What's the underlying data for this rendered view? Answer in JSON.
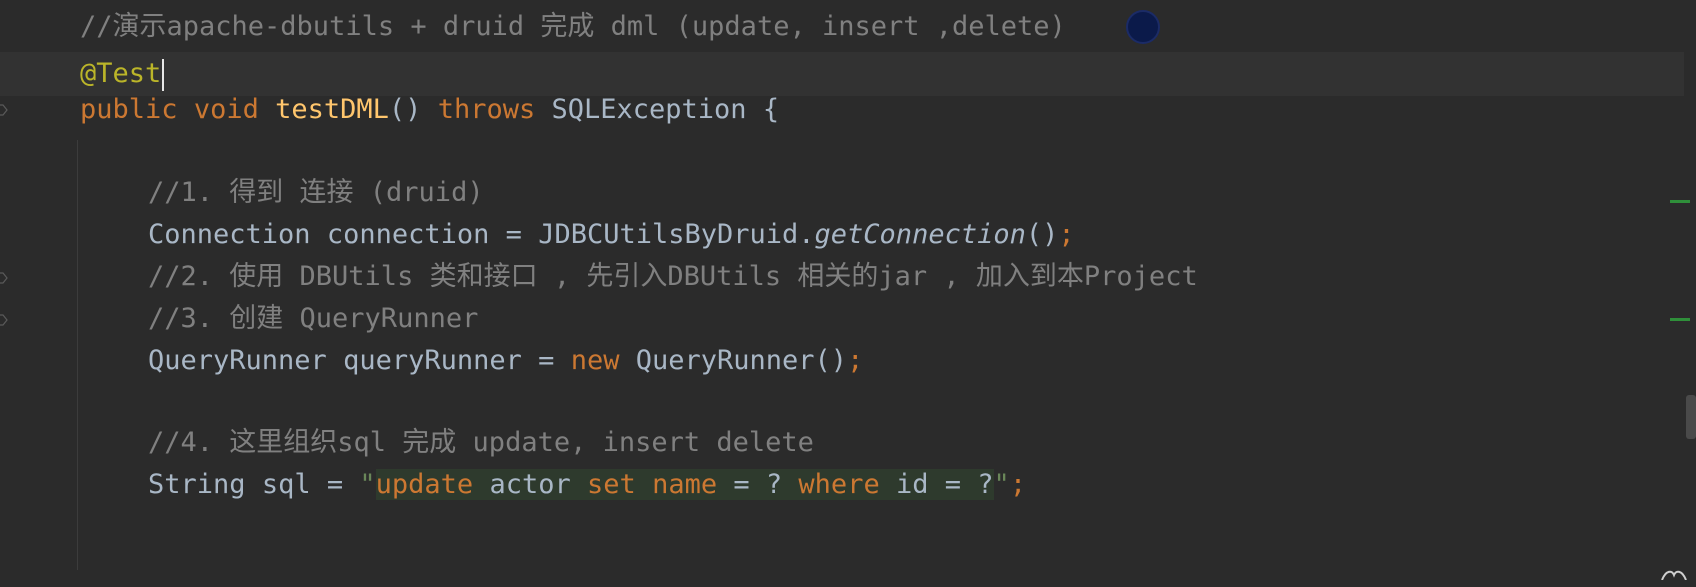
{
  "editor": {
    "lines": [
      {
        "comment": "//演示apache-dbutils + druid 完成 dml (update, insert ,delete)"
      },
      {
        "annotation": "@Test"
      },
      {
        "kw_public": "public",
        "kw_void": "void",
        "method": "testDML",
        "parens": "()",
        "kw_throws": "throws",
        "exception": "SQLException",
        "brace": "{"
      },
      {
        "comment": "//1. 得到 连接 (druid)"
      },
      {
        "type": "Connection",
        "var": "connection",
        "eq": "=",
        "cls": "JDBCUtilsByDruid.",
        "call": "getConnection",
        "tail": "()",
        "semi": ";"
      },
      {
        "comment": "//2. 使用 DBUtils 类和接口 , 先引入DBUtils 相关的jar , 加入到本Project"
      },
      {
        "comment": "//3. 创建 QueryRunner"
      },
      {
        "type": "QueryRunner",
        "var": "queryRunner",
        "eq": "=",
        "kw_new": "new",
        "ctor": "QueryRunner()",
        "semi": ";"
      },
      {
        "comment": "//4. 这里组织sql 完成 update, insert delete"
      },
      {
        "type": "String",
        "var": "sql",
        "eq": "=",
        "quote_open": "\"",
        "sql_update": "update",
        "sql_table": "actor",
        "sql_set": "set",
        "sql_col": "name",
        "sql_eq1": "=",
        "sql_q1": "?",
        "sql_where": "where",
        "sql_id": "id",
        "sql_eq2": "=",
        "sql_q2": "?",
        "quote_close": "\"",
        "semi": ";"
      }
    ]
  },
  "colors": {
    "background": "#2b2b2b",
    "keyword": "#cc7832",
    "comment": "#808080",
    "method": "#ffc66d",
    "annotation": "#bbb529",
    "text": "#a9b7c6",
    "string": "#6a8759"
  }
}
